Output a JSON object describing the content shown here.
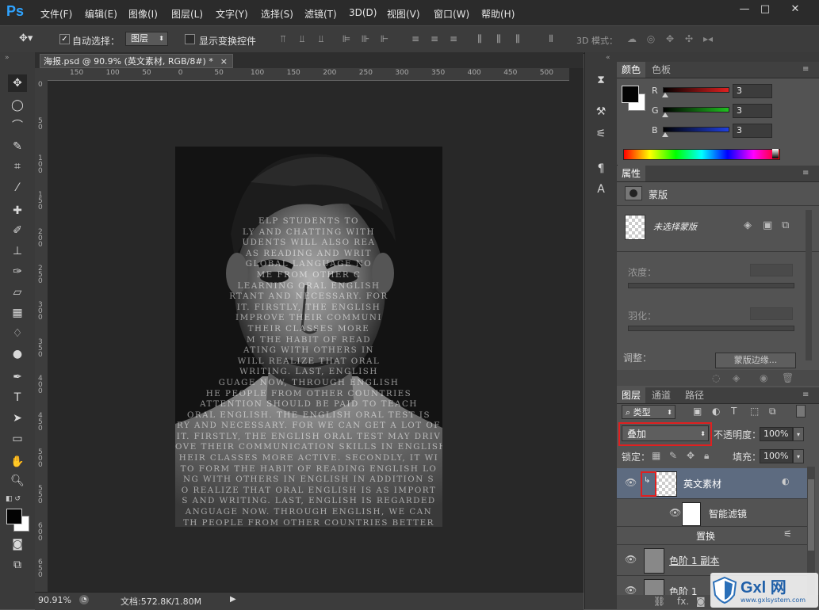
{
  "app": {
    "logo": "Ps"
  },
  "menu": [
    "文件(F)",
    "编辑(E)",
    "图像(I)",
    "图层(L)",
    "文字(Y)",
    "选择(S)",
    "滤镜(T)",
    "3D(D)",
    "视图(V)",
    "窗口(W)",
    "帮助(H)"
  ],
  "window_controls": {
    "minimize": "—",
    "maximize": "□",
    "close": "✕"
  },
  "options": {
    "auto_select_label": "自动选择：",
    "auto_select_checked": true,
    "auto_select_value": "图层",
    "show_transform_label": "显示变换控件",
    "mode_3d_label": "3D 模式："
  },
  "document": {
    "tab_title": "海报.psd @ 90.9% (英文素材, RGB/8#) *",
    "tab_close": "×",
    "ruler_top": [
      "150",
      "100",
      "50",
      "0",
      "50",
      "100",
      "150",
      "200",
      "250",
      "300",
      "350",
      "400",
      "450",
      "500"
    ],
    "ruler_left": [
      "0",
      "5 0",
      "1 0 0",
      "1 5 0",
      "2 0 0",
      "2 5 0",
      "3 0 0",
      "3 5 0",
      "4 0 0",
      "4 5 0",
      "5 0 0",
      "5 5 0",
      "6 0 0",
      "6 5 0"
    ],
    "canvas_text": [
      "ELP STUDENTS TO",
      "LY AND CHATTING WITH",
      "UDENTS WILL ALSO REA",
      "AS READING AND WRIT",
      "GLOBAL LANGUAGE NO",
      "ME FROM OTHER C",
      "LEARNING ORAL ENGLISH",
      "RTANT AND NECESSARY. FOR",
      "IT. FIRSTLY, THE ENGLISH",
      "IMPROVE THEIR COMMUNI",
      "THEIR CLASSES MORE",
      "M THE HABIT OF READ",
      "ATING WITH OTHERS IN",
      "WILL REALIZE THAT ORAL",
      "WRITING. LAST, ENGLISH",
      "GUAGE NOW, THROUGH ENGLISH",
      "HE PEOPLE FROM OTHER COUNTRIES",
      "ATTENTION SHOULD BE PAID TO TEACH",
      "ORAL ENGLISH. THE ENGLISH ORAL TEST IS",
      "RY AND NECESSARY. FOR WE CAN GET A LOT OF",
      "IT. FIRSTLY, THE ENGLISH ORAL TEST MAY DRIV",
      "OVE THEIR COMMUNICATION SKILLS IN ENGLISH",
      "HEIR CLASSES MORE ACTIVE. SECONDLY, IT WI",
      "TO FORM THE HABIT OF READING ENGLISH LO",
      "NG WITH OTHERS IN ENGLISH IN ADDITION S",
      "O REALIZE THAT ORAL ENGLISH IS AS IMPORT",
      "S AND WRITING. LAST, ENGLISH IS REGARDED",
      "ANGUAGE NOW. THROUGH ENGLISH, WE CAN",
      "TH PEOPLE FROM OTHER COUNTRIES BETTER"
    ]
  },
  "status": {
    "zoom": "90.91%",
    "doc_info": "文档:572.8K/1.80M"
  },
  "color_panel": {
    "tabs": [
      "颜色",
      "色板"
    ],
    "channels": [
      {
        "label": "R",
        "value": "3",
        "color": "#e02020"
      },
      {
        "label": "G",
        "value": "3",
        "color": "#20c020"
      },
      {
        "label": "B",
        "value": "3",
        "color": "#2040e0"
      }
    ]
  },
  "properties_panel": {
    "tab": "属性",
    "mode": "蒙版",
    "mask_label": "未选择蒙版",
    "density_label": "浓度：",
    "feather_label": "羽化：",
    "adjust_label": "调整：",
    "mask_edge_button": "蒙版边缘..."
  },
  "layers_panel": {
    "tabs": [
      "图层",
      "通道",
      "路径"
    ],
    "filter_type": "类型",
    "blend_mode": "叠加",
    "opacity_label": "不透明度：",
    "opacity_value": "100%",
    "lock_label": "锁定：",
    "fill_label": "填充：",
    "fill_value": "100%",
    "layers": [
      {
        "name": "英文素材",
        "selected": true
      },
      {
        "name": "智能滤镜",
        "selected": false
      },
      {
        "name": "置换",
        "selected": false
      },
      {
        "name": "色阶 1 副本",
        "selected": false
      },
      {
        "name": "色阶 1",
        "selected": false
      }
    ],
    "footer_fx": "fx."
  },
  "watermark": {
    "text": "Gxl 网",
    "sub": "www.gxlsystem.com"
  }
}
